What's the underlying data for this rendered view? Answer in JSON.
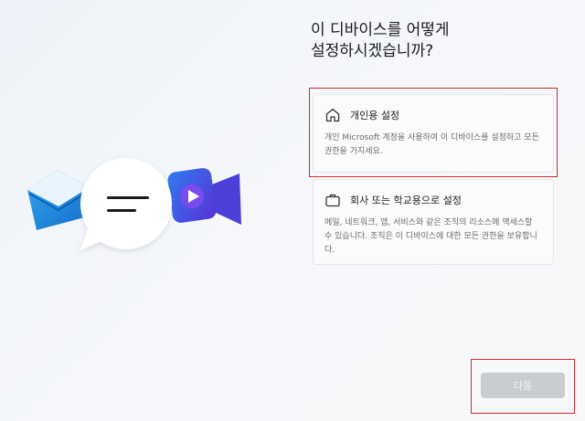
{
  "setup": {
    "title": "이 디바이스를 어떻게 설정하시겠습니까?",
    "options": [
      {
        "icon": "home-icon",
        "title": "개인용 설정",
        "description": "개인 Microsoft 계정을 사용하여 이 디바이스를 설정하고 모든 권한을 가지세요."
      },
      {
        "icon": "briefcase-icon",
        "title": "회사 또는 학교용으로 설정",
        "description": "메일, 네트워크, 앱, 서비스와 같은 조직의 리소스에 액세스할 수 있습니다. 조직은 이 디바이스에 대한 모든 권한을 보유합니다."
      }
    ],
    "next_label": "다음",
    "next_enabled": false
  },
  "colors": {
    "highlight": "#d42a2a",
    "mail_blue": "#1f8fe0",
    "video_blue": "#3a4fd9",
    "button_disabled": "#c9ccd1"
  }
}
